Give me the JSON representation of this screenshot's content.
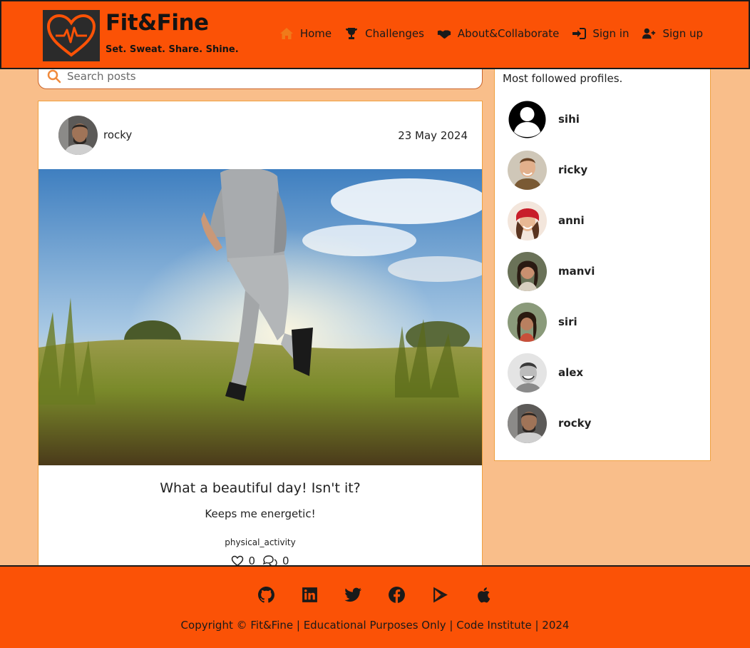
{
  "brand": {
    "title": "Fit&Fine",
    "slogan": "Set. Sweat. Share. Shine."
  },
  "nav": {
    "items": [
      {
        "label": "Home",
        "icon": "home-icon"
      },
      {
        "label": "Challenges",
        "icon": "trophy-icon"
      },
      {
        "label": "About&Collaborate",
        "icon": "handshake-icon"
      },
      {
        "label": "Sign in",
        "icon": "sign-in-icon"
      },
      {
        "label": "Sign up",
        "icon": "user-plus-icon"
      }
    ]
  },
  "search": {
    "placeholder": "Search posts",
    "icon": "search-icon"
  },
  "post": {
    "author": "rocky",
    "date": "23 May 2024",
    "title": "What a beautiful day! Isn't it?",
    "body": "Keeps me energetic!",
    "tag": "physical_activity",
    "likes": "0",
    "comments": "0"
  },
  "sidebar": {
    "title": "Most followed profiles.",
    "profiles": [
      {
        "name": "sihi"
      },
      {
        "name": "ricky"
      },
      {
        "name": "anni"
      },
      {
        "name": "manvi"
      },
      {
        "name": "siri"
      },
      {
        "name": "alex"
      },
      {
        "name": "rocky"
      }
    ]
  },
  "footer": {
    "social": [
      "github-icon",
      "linkedin-icon",
      "twitter-icon",
      "facebook-icon",
      "google-play-icon",
      "apple-icon"
    ],
    "copyright": "Copyright © Fit&Fine | Educational Purposes Only | Code Institute | 2024"
  },
  "colors": {
    "brand": "#fb5206",
    "page_bg": "#f9be8a",
    "card_border": "#f0a040"
  }
}
